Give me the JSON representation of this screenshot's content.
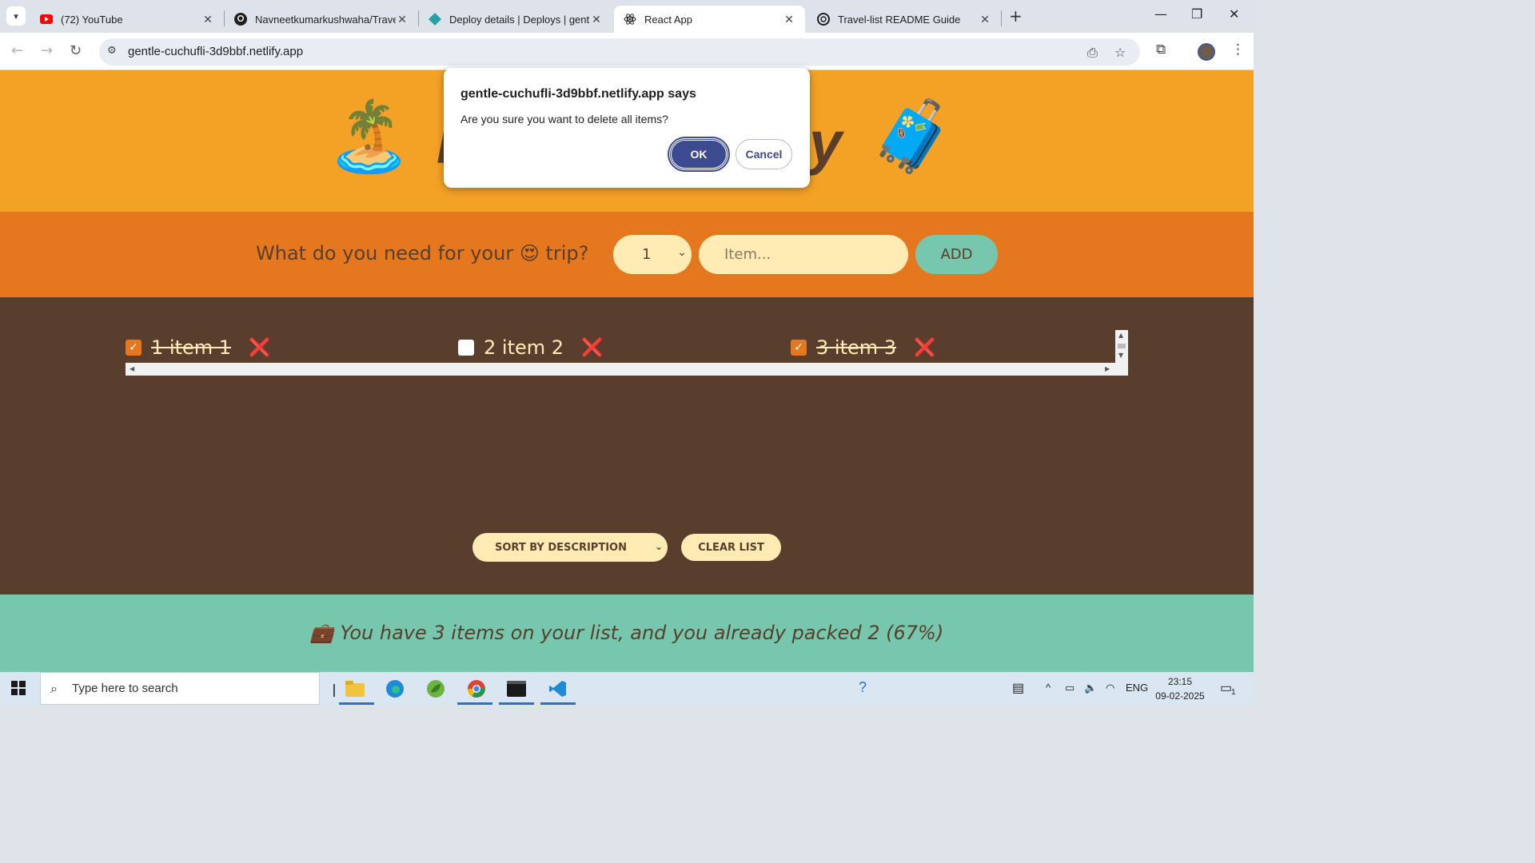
{
  "browser": {
    "tabs": [
      {
        "title": "(72) YouTube",
        "icon": "youtube-icon"
      },
      {
        "title": "Navneetkumarkushwaha/Travel",
        "icon": "github-icon"
      },
      {
        "title": "Deploy details | Deploys | gentl",
        "icon": "netlify-icon"
      },
      {
        "title": "React App",
        "icon": "react-icon",
        "active": true
      },
      {
        "title": "Travel-list README Guide",
        "icon": "chatgpt-icon"
      }
    ],
    "url": "gentle-cuchufli-3d9bbf.netlify.app"
  },
  "app": {
    "header_emoji_left": "🏝️",
    "header_emoji_right": "🧳",
    "form": {
      "question_prefix": "What do you need for your",
      "question_emoji": "😍",
      "question_suffix": "trip?",
      "quantity": "1",
      "item_placeholder": "Item...",
      "add_label": "ADD"
    },
    "items": [
      {
        "quantity": "1",
        "description": "item 1",
        "packed": true,
        "text": "1 item 1"
      },
      {
        "quantity": "2",
        "description": "item 2",
        "packed": false,
        "text": "2 item 2"
      },
      {
        "quantity": "3",
        "description": "item 3",
        "packed": true,
        "text": "3 item 3"
      }
    ],
    "delete_glyph": "❌",
    "sort_label": "SORT BY DESCRIPTION",
    "clear_label": "CLEAR LIST",
    "stats_text": "💼 You have 3 items on your list, and you already packed 2 (67%)"
  },
  "dialog": {
    "title": "gentle-cuchufli-3d9bbf.netlify.app says",
    "message": "Are you sure you want to delete all items?",
    "ok_label": "OK",
    "cancel_label": "Cancel"
  },
  "taskbar": {
    "search_placeholder": "Type here to search",
    "language": "ENG",
    "time": "23:15",
    "date": "09-02-2025",
    "notification_count": "1"
  },
  "colors": {
    "header": "#f4a226",
    "form": "#e5771f",
    "list": "#5a3e2d",
    "stats": "#76c7ad",
    "cream": "#ffebb3",
    "dialog_accent": "#3c4a8f"
  }
}
